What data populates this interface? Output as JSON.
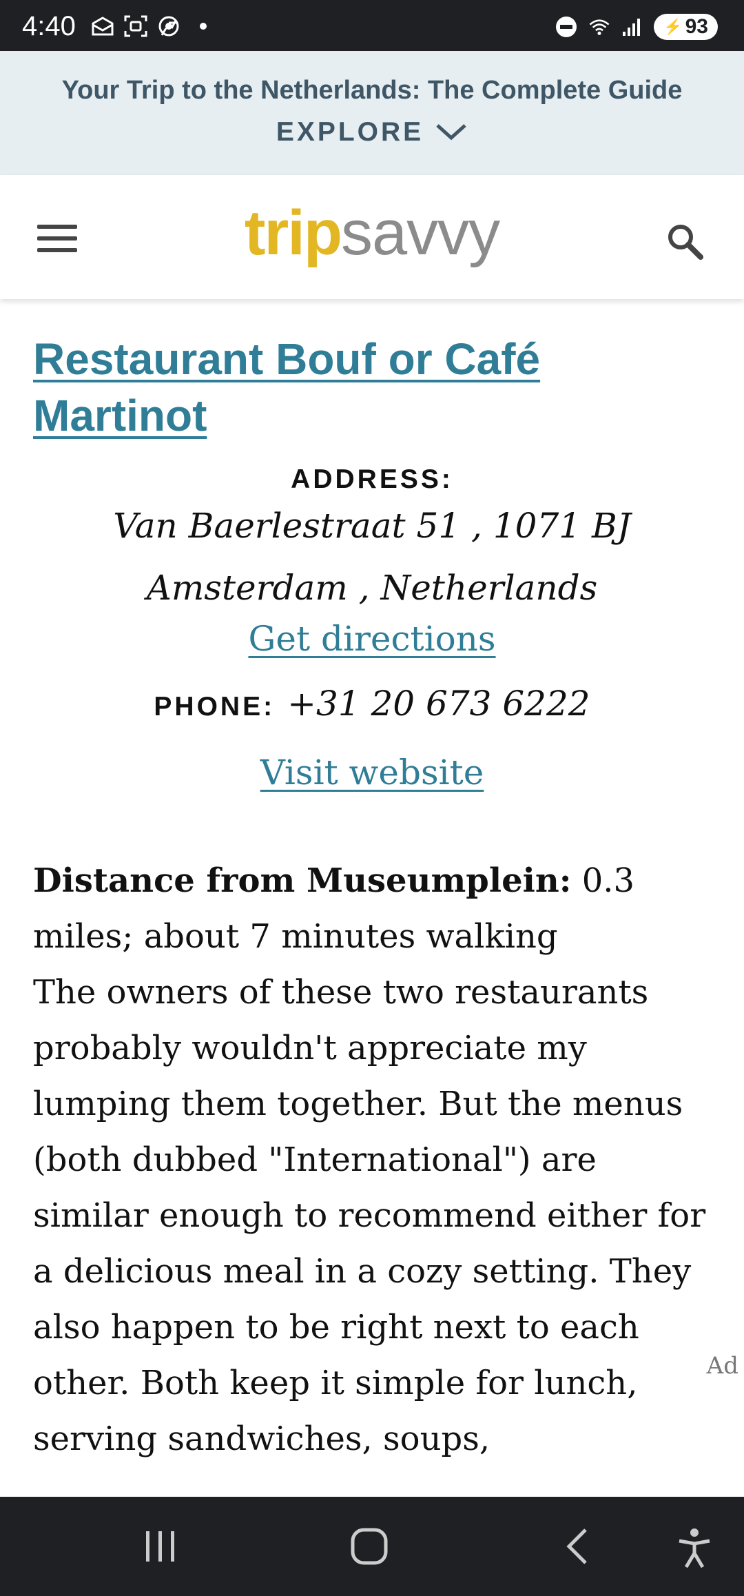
{
  "status_bar": {
    "time": "4:40",
    "battery": "93",
    "icons": [
      "mail-icon",
      "screenshot-icon",
      "chrome-icon",
      "dot-icon",
      "dnd-icon",
      "wifi-icon",
      "signal-icon",
      "battery-icon"
    ]
  },
  "promo": {
    "title": "Your Trip to the Netherlands: The Complete Guide",
    "explore": "EXPLORE"
  },
  "header": {
    "logo_trip": "trip",
    "logo_savvy": "savvy"
  },
  "listing": {
    "title": "Restaurant Bouf or Café Martinot",
    "address_label": "ADDRESS:",
    "address_line1": "Van Baerlestraat 51 , 1071 BJ",
    "address_line2": "Amsterdam , Netherlands",
    "directions_link": "Get directions",
    "phone_label": "PHONE:",
    "phone_value": "+31 20 673 6222",
    "website_link": "Visit website"
  },
  "article": {
    "distance_label": "Distance from Museumplein:",
    "distance_value": " 0.3 miles; about 7 minutes walking",
    "paragraph": "The owners of these two restaurants probably wouldn't appreciate my lumping them together. But the menus (both dubbed \"International\") are similar enough to recommend either for a delicious meal in a cozy setting. They also happen to be right next to each other. Both keep it simple for lunch, serving sandwiches, soups,",
    "ad_label": "Ad"
  }
}
